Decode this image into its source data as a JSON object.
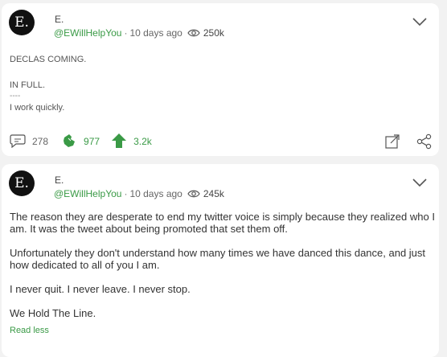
{
  "posts": [
    {
      "avatar_letter": "E.",
      "author": "E.",
      "handle": "@EWillHelpYou",
      "time": "10 days ago",
      "views": "250k",
      "lines": [
        "DECLAS COMING.",
        "",
        "IN FULL.",
        "----",
        "I work quickly."
      ],
      "comments": "278",
      "reactions": "977",
      "upvotes": "3.2k"
    },
    {
      "avatar_letter": "E.",
      "author": "E.",
      "handle": "@EWillHelpYou",
      "time": "10 days ago",
      "views": "245k",
      "paragraphs": [
        "The reason they are desperate to end my twitter voice is simply because they realized who I am. It was the tweet about being promoted that set them off.",
        "Unfortunately they don't understand how many times we have danced this dance, and just how dedicated to all of you I am.",
        "I never quit. I never leave. I never stop.",
        "We Hold The Line."
      ],
      "read_less": "Read less"
    }
  ],
  "colors": {
    "accent": "#3a9a46",
    "background": "#f2f2f2",
    "card": "#ffffff"
  },
  "icons": [
    "eye-icon",
    "chevron-down-icon",
    "comment-icon",
    "reaction-icon",
    "upvote-icon",
    "expand-icon",
    "share-icon"
  ]
}
